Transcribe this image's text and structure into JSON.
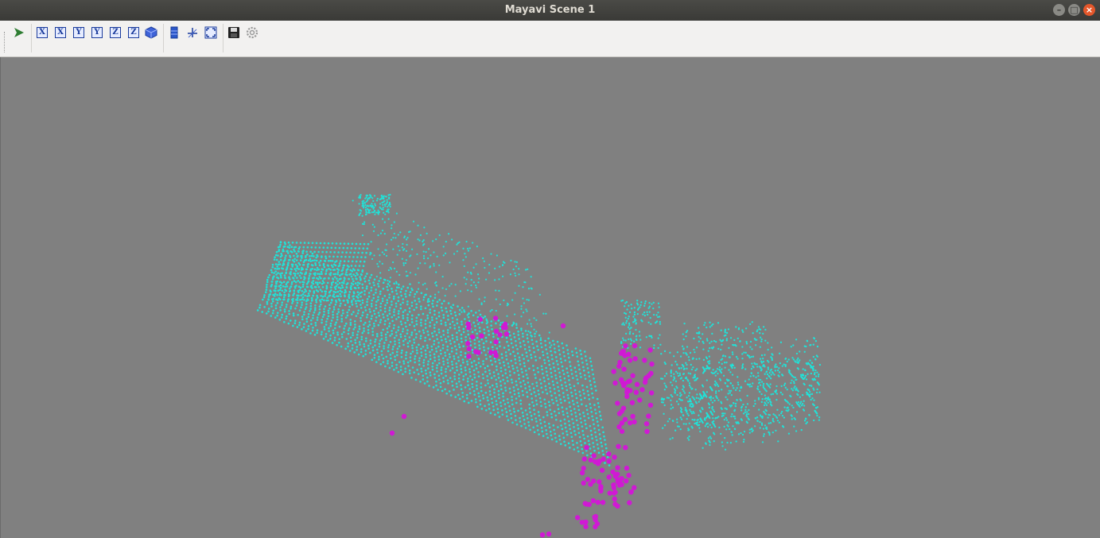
{
  "window": {
    "title": "Mayavi Scene 1",
    "buttons": {
      "minimize": "–",
      "maximize": "□",
      "close": "×"
    }
  },
  "toolbar": {
    "items": [
      {
        "icon": "mayavi-pipeline-icon",
        "glyph": "➤"
      },
      {
        "icon": "view-x-plus-icon",
        "glyph": "X"
      },
      {
        "icon": "view-x-minus-icon",
        "glyph": "X"
      },
      {
        "icon": "view-y-plus-icon",
        "glyph": "Y"
      },
      {
        "icon": "view-y-minus-icon",
        "glyph": "Y"
      },
      {
        "icon": "view-z-plus-icon",
        "glyph": "Z"
      },
      {
        "icon": "view-z-minus-icon",
        "glyph": "Z"
      },
      {
        "icon": "isometric-view-icon",
        "glyph": "⬢"
      },
      {
        "icon": "parallel-projection-icon",
        "glyph": "▮"
      },
      {
        "icon": "axes-indicator-icon",
        "glyph": "✣"
      },
      {
        "icon": "full-screen-icon",
        "glyph": "⛶"
      },
      {
        "icon": "save-scene-icon",
        "glyph": "💾"
      },
      {
        "icon": "configure-scene-icon",
        "glyph": "⚙"
      }
    ]
  },
  "scene": {
    "background": "#808080",
    "point_cloud_color": "#1fe3d9",
    "highlight_color": "#d019d4"
  }
}
